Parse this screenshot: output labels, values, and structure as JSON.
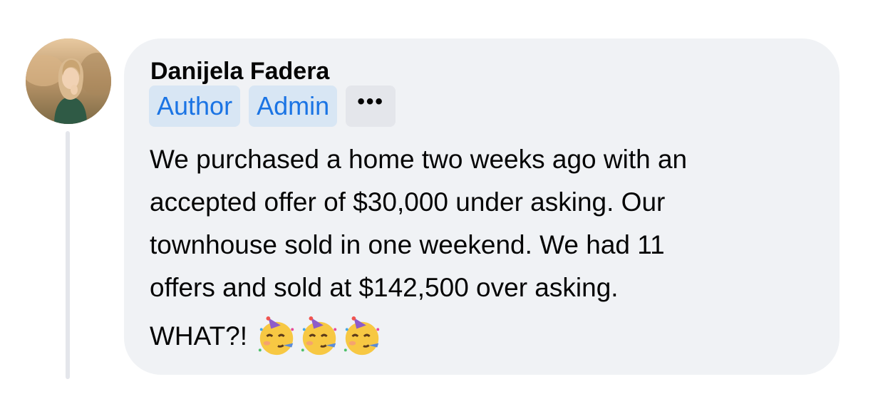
{
  "comment": {
    "author": "Danijela Fadera",
    "badges": {
      "author": "Author",
      "admin": "Admin"
    },
    "more_label": "•••",
    "body_lines": [
      "We purchased a home two weeks ago with an",
      "accepted offer of $30,000 under asking. Our",
      "townhouse sold in one weekend. We had 11",
      "offers and sold at $142,500 over asking."
    ],
    "exclamation": "WHAT?!",
    "emojis": [
      "partying-face-icon",
      "partying-face-icon",
      "partying-face-icon"
    ]
  },
  "colors": {
    "bubble": "#f0f2f5",
    "badge_bg": "#d8e6f4",
    "badge_text": "#1b74e4",
    "text": "#050505"
  }
}
